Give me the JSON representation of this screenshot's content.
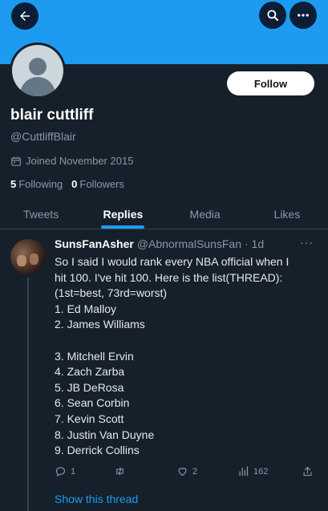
{
  "header": {
    "back_icon": "arrow-left-icon",
    "search_icon": "search-icon",
    "more_icon": "ellipsis-icon",
    "banner_color": "#1d9bf0"
  },
  "profile": {
    "display_name": "blair cuttliff",
    "handle": "@CuttliffBlair",
    "joined": "Joined November 2015",
    "following_count": "5",
    "following_label": "Following",
    "followers_count": "0",
    "followers_label": "Followers",
    "follow_button": "Follow"
  },
  "tabs": [
    {
      "label": "Tweets",
      "active": false
    },
    {
      "label": "Replies",
      "active": true
    },
    {
      "label": "Media",
      "active": false
    },
    {
      "label": "Likes",
      "active": false
    }
  ],
  "tweet": {
    "author_name": "SunsFanAsher",
    "author_handle": "@AbnormalSunsFan",
    "time": "· 1d",
    "more": "···",
    "lines": [
      "So I said I would rank every NBA official when I",
      "hit 100. I've hit 100. Here is the list(THREAD):",
      "(1st=best, 73rd=worst)",
      "1. Ed Malloy",
      "2. James Williams",
      "",
      "3. Mitchell Ervin",
      "4. Zach Zarba",
      "5. JB DeRosa",
      "6. Sean Corbin",
      "7. Kevin Scott",
      "8. Justin Van Duyne",
      "9. Derrick Collins"
    ],
    "replies": "1",
    "retweets": "",
    "likes": "2",
    "views": "162",
    "show_thread": "Show this thread"
  }
}
